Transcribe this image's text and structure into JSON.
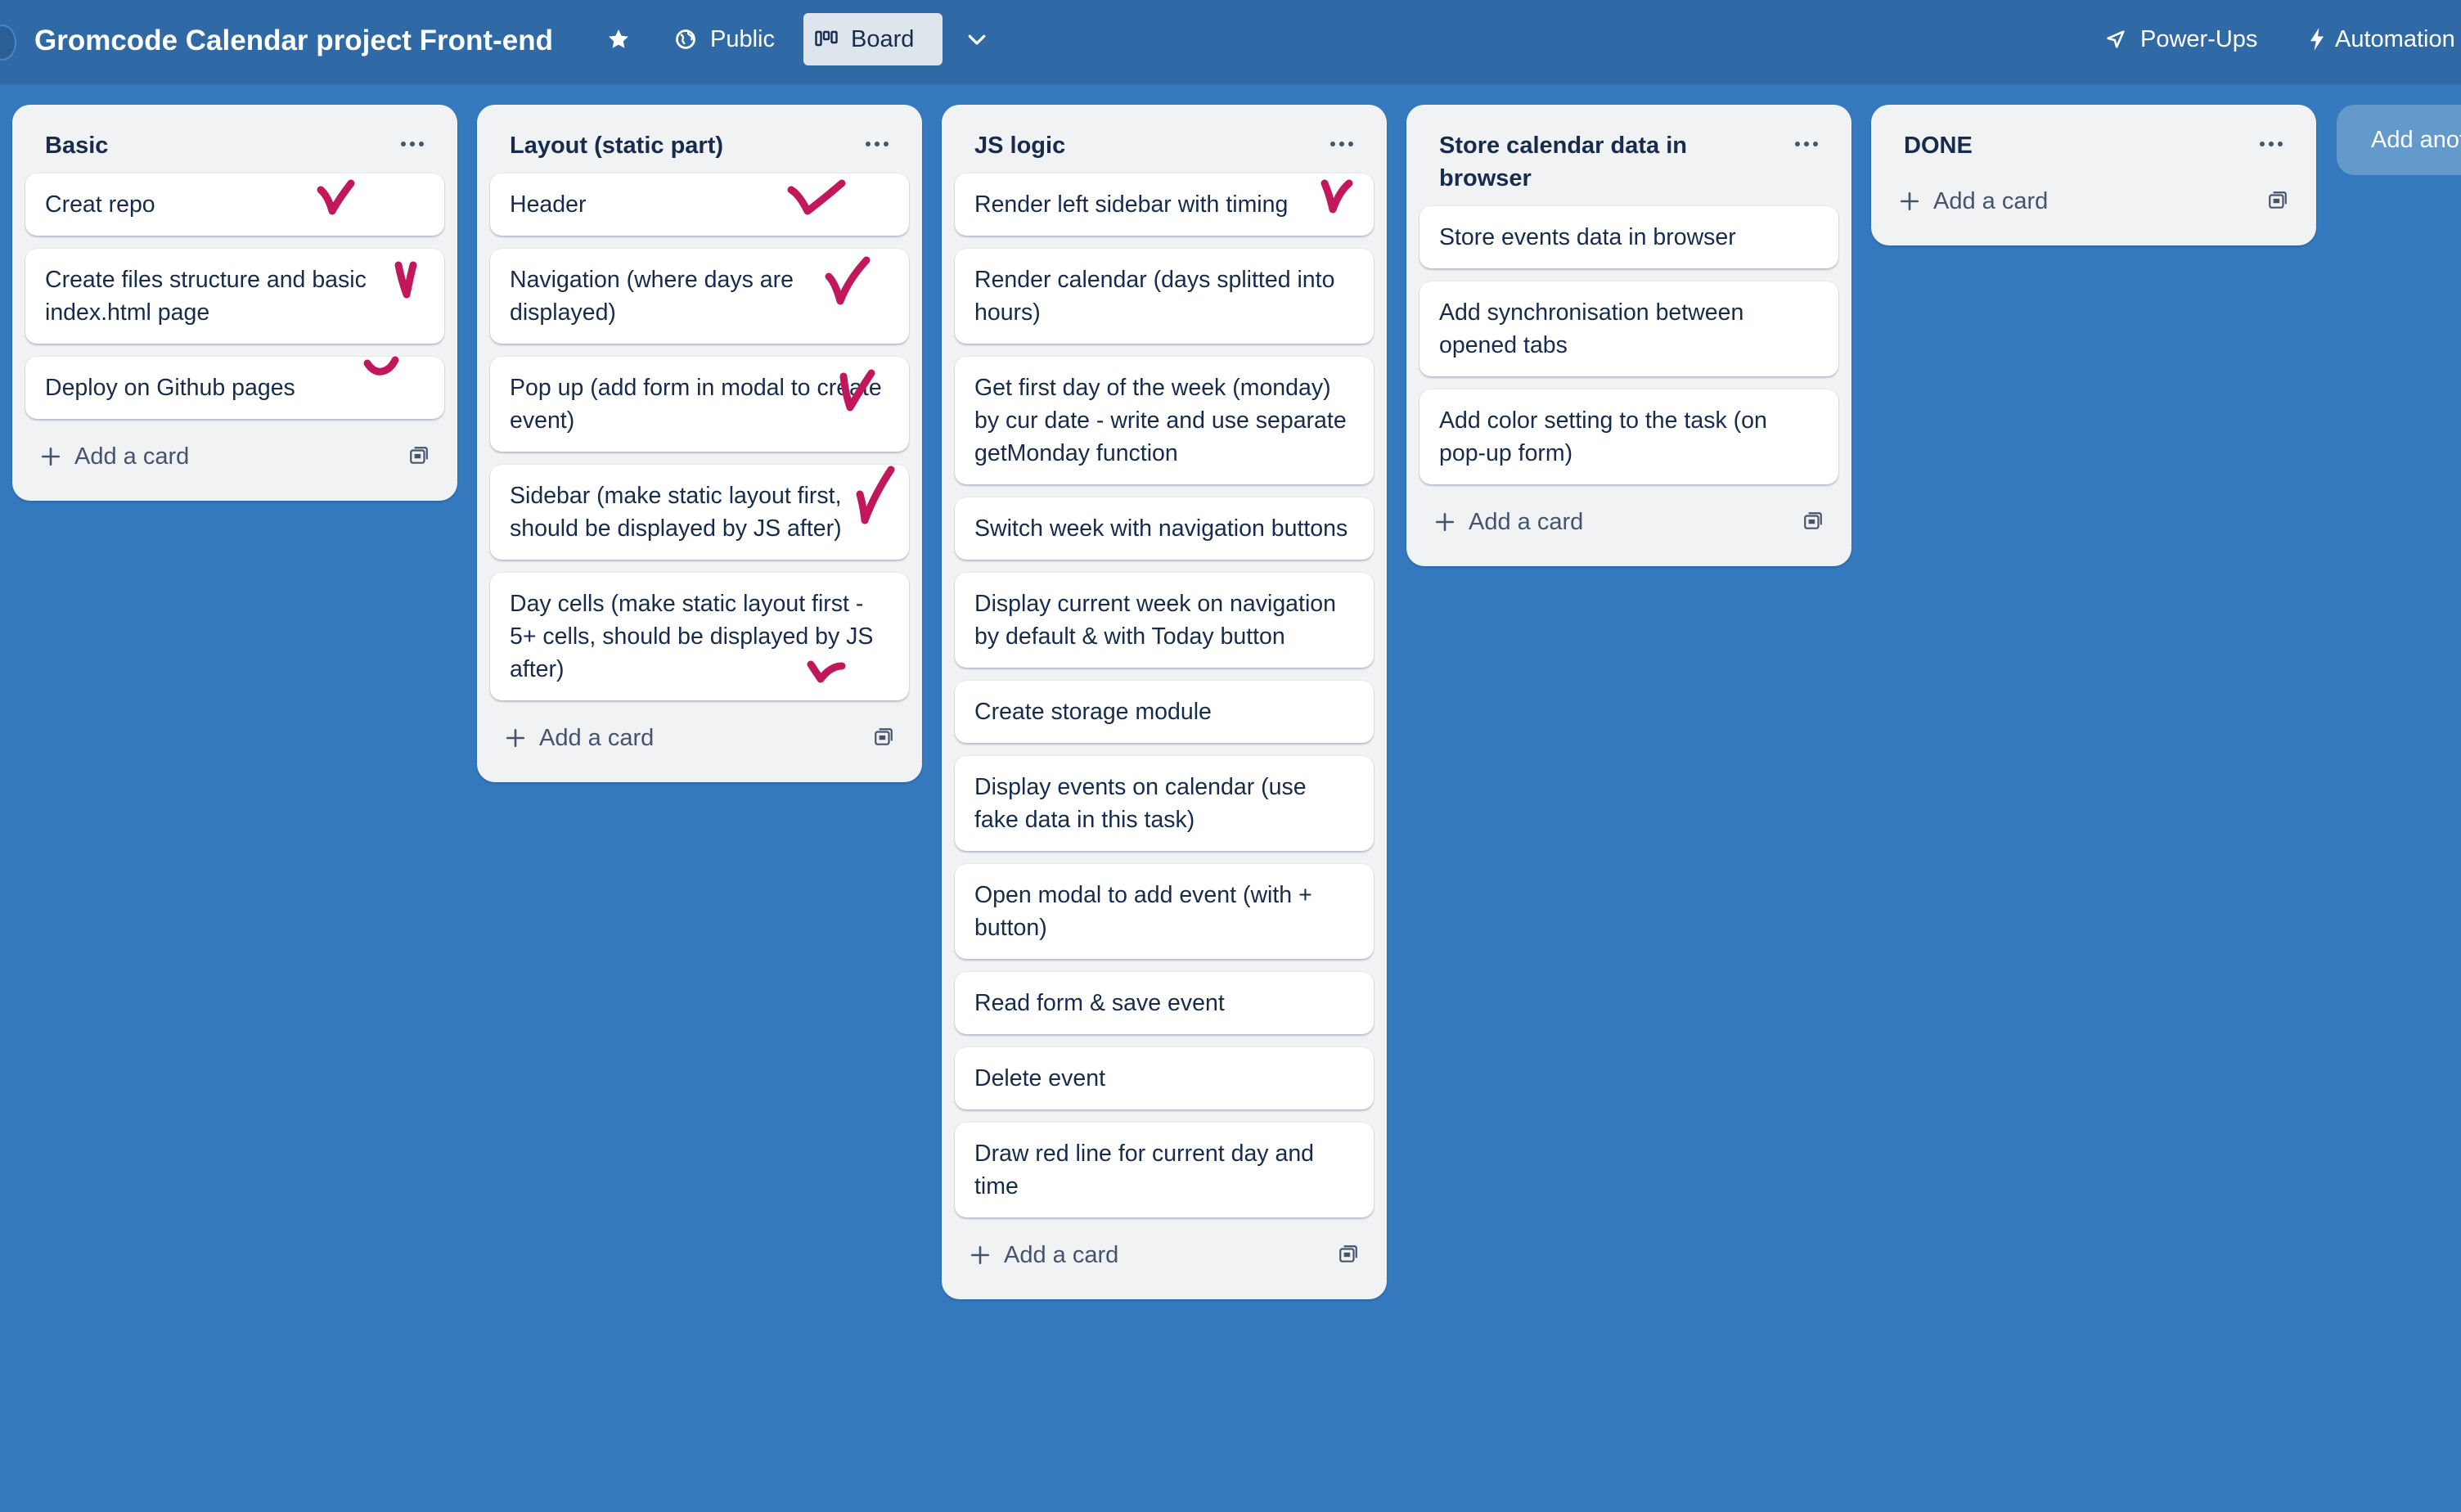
{
  "header": {
    "board_title": "Gromcode Calendar project Front-end",
    "visibility_label": "Public",
    "view_label": "Board",
    "powerups_label": "Power-Ups",
    "automation_label": "Automation",
    "colors": {
      "header_bg": "#2f6aa6",
      "board_bg": "#3479bd",
      "active_view_bg": "#dfe5ec"
    }
  },
  "lists": [
    {
      "title": "Basic",
      "cards": [
        {
          "text": "Creat repo",
          "checked": true
        },
        {
          "text": "Create files structure and basic index.html page",
          "checked": true
        },
        {
          "text": "Deploy on Github pages",
          "checked": true
        }
      ],
      "add_label": "Add a card"
    },
    {
      "title": "Layout (static part)",
      "cards": [
        {
          "text": "Header",
          "checked": true
        },
        {
          "text": "Navigation (where days are displayed)",
          "checked": true
        },
        {
          "text": "Pop up (add form in modal to create event)",
          "checked": true
        },
        {
          "text": "Sidebar (make static layout first, should be displayed by JS after)",
          "checked": true
        },
        {
          "text": "Day cells (make static layout first - 5+ cells, should be displayed by JS after)",
          "checked": true
        }
      ],
      "add_label": "Add a card"
    },
    {
      "title": "JS logic",
      "cards": [
        {
          "text": "Render left sidebar with timing",
          "checked": true
        },
        {
          "text": "Render calendar (days splitted into hours)"
        },
        {
          "text": "Get first day of the week (monday) by cur date - write and use separate getMonday function"
        },
        {
          "text": "Switch week with navigation buttons"
        },
        {
          "text": "Display current week on navigation by default & with Today button"
        },
        {
          "text": "Create storage module"
        },
        {
          "text": "Display events on calendar (use fake data in this task)"
        },
        {
          "text": "Open modal to add event (with + button)"
        },
        {
          "text": "Read form & save event"
        },
        {
          "text": "Delete event"
        },
        {
          "text": "Draw red line for current day and time"
        }
      ],
      "add_label": "Add a card"
    },
    {
      "title": "Store calendar data in browser",
      "cards": [
        {
          "text": "Store events data in browser"
        },
        {
          "text": "Add synchronisation between opened tabs"
        },
        {
          "text": "Add color setting to the task (on pop-up form)"
        }
      ],
      "add_label": "Add a card"
    },
    {
      "title": "DONE",
      "cards": [],
      "add_label": "Add a card"
    }
  ],
  "add_list_label": "Add another list",
  "checkmark_color": "#c2185b"
}
